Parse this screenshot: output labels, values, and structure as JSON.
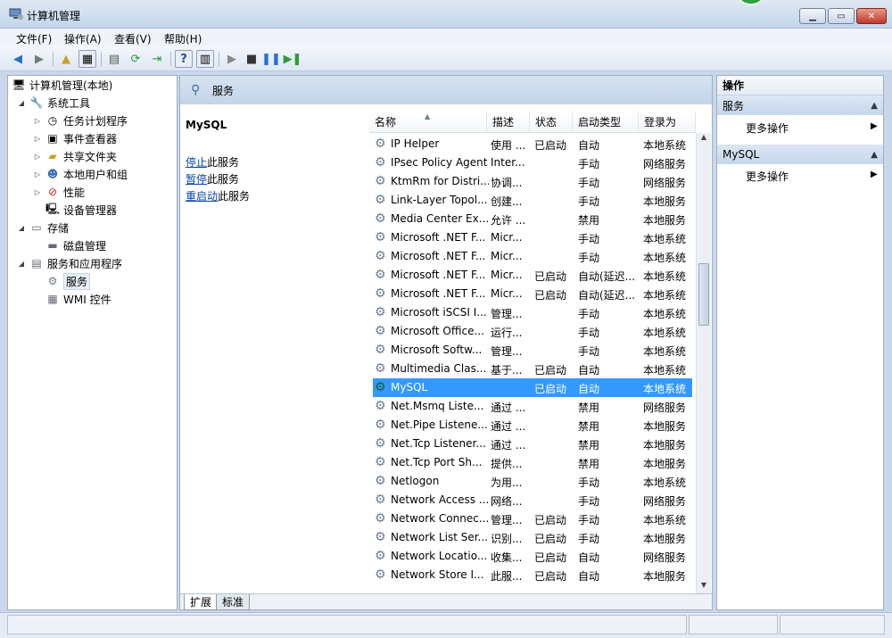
{
  "window": {
    "title": "计算机管理"
  },
  "menu": [
    "文件(F)",
    "操作(A)",
    "查看(V)",
    "帮助(H)"
  ],
  "tree": {
    "items": [
      {
        "label": "计算机管理(本地)",
        "icon": "computer-icon",
        "toggle": ""
      },
      {
        "label": "系统工具",
        "icon": "tools-icon",
        "toggle": "◢"
      },
      {
        "label": "任务计划程序",
        "icon": "clock-icon",
        "toggle": "▷"
      },
      {
        "label": "事件查看器",
        "icon": "event-viewer-icon",
        "toggle": "▷"
      },
      {
        "label": "共享文件夹",
        "icon": "shared-folder-icon",
        "toggle": "▷"
      },
      {
        "label": "本地用户和组",
        "icon": "users-icon",
        "toggle": "▷"
      },
      {
        "label": "性能",
        "icon": "performance-icon",
        "toggle": "▷"
      },
      {
        "label": "设备管理器",
        "icon": "device-manager-icon",
        "toggle": ""
      },
      {
        "label": "存储",
        "icon": "storage-icon",
        "toggle": "◢"
      },
      {
        "label": "磁盘管理",
        "icon": "disk-icon",
        "toggle": ""
      },
      {
        "label": "服务和应用程序",
        "icon": "services-apps-icon",
        "toggle": "◢"
      },
      {
        "label": "服务",
        "icon": "gear-icon",
        "toggle": ""
      },
      {
        "label": "WMI 控件",
        "icon": "wmi-icon",
        "toggle": ""
      }
    ]
  },
  "middle": {
    "header_title": "服务",
    "detail": {
      "service_name": "MySQL",
      "stop_link": "停止",
      "stop_rest": "此服务",
      "pause_link": "暂停",
      "pause_rest": "此服务",
      "restart_link": "重启动",
      "restart_rest": "此服务"
    },
    "columns": [
      "名称",
      "描述",
      "状态",
      "启动类型",
      "登录为"
    ],
    "services": [
      [
        "IP Helper",
        "使用 ...",
        "已启动",
        "自动",
        "本地系统"
      ],
      [
        "IPsec Policy Agent",
        "Inter...",
        "",
        "手动",
        "网络服务"
      ],
      [
        "KtmRm for Distri...",
        "协调...",
        "",
        "手动",
        "网络服务"
      ],
      [
        "Link-Layer Topol...",
        "创建...",
        "",
        "手动",
        "本地服务"
      ],
      [
        "Media Center Ex...",
        "允许 ...",
        "",
        "禁用",
        "本地服务"
      ],
      [
        "Microsoft .NET F...",
        "Micr...",
        "",
        "手动",
        "本地系统"
      ],
      [
        "Microsoft .NET F...",
        "Micr...",
        "",
        "手动",
        "本地系统"
      ],
      [
        "Microsoft .NET F...",
        "Micr...",
        "已启动",
        "自动(延迟...",
        "本地系统"
      ],
      [
        "Microsoft .NET F...",
        "Micr...",
        "已启动",
        "自动(延迟...",
        "本地系统"
      ],
      [
        "Microsoft iSCSI I...",
        "管理...",
        "",
        "手动",
        "本地系统"
      ],
      [
        "Microsoft Office...",
        "运行...",
        "",
        "手动",
        "本地系统"
      ],
      [
        "Microsoft Softw...",
        "管理...",
        "",
        "手动",
        "本地系统"
      ],
      [
        "Multimedia Clas...",
        "基于...",
        "已启动",
        "自动",
        "本地系统"
      ],
      [
        "MySQL",
        "",
        "已启动",
        "自动",
        "本地系统"
      ],
      [
        "Net.Msmq Liste...",
        "通过 ...",
        "",
        "禁用",
        "网络服务"
      ],
      [
        "Net.Pipe Listene...",
        "通过 ...",
        "",
        "禁用",
        "本地服务"
      ],
      [
        "Net.Tcp Listener...",
        "通过 ...",
        "",
        "禁用",
        "本地服务"
      ],
      [
        "Net.Tcp Port Sh...",
        "提供...",
        "",
        "禁用",
        "本地服务"
      ],
      [
        "Netlogon",
        "为用...",
        "",
        "手动",
        "本地系统"
      ],
      [
        "Network Access ...",
        "网络...",
        "",
        "手动",
        "网络服务"
      ],
      [
        "Network Connec...",
        "管理...",
        "已启动",
        "手动",
        "本地系统"
      ],
      [
        "Network List Ser...",
        "识别...",
        "已启动",
        "手动",
        "本地服务"
      ],
      [
        "Network Locatio...",
        "收集...",
        "已启动",
        "自动",
        "网络服务"
      ],
      [
        "Network Store I...",
        "此服...",
        "已启动",
        "自动",
        "本地服务"
      ]
    ],
    "selected_index": 13,
    "tabs": [
      "扩展",
      "标准"
    ]
  },
  "actions": {
    "title": "操作",
    "sections": [
      {
        "label": "服务",
        "more": "更多操作"
      },
      {
        "label": "MySQL",
        "more": "更多操作"
      }
    ]
  },
  "colors": {
    "selection": "#3399ff",
    "link": "#0645ad",
    "header_bg": "#c3d4e8"
  }
}
